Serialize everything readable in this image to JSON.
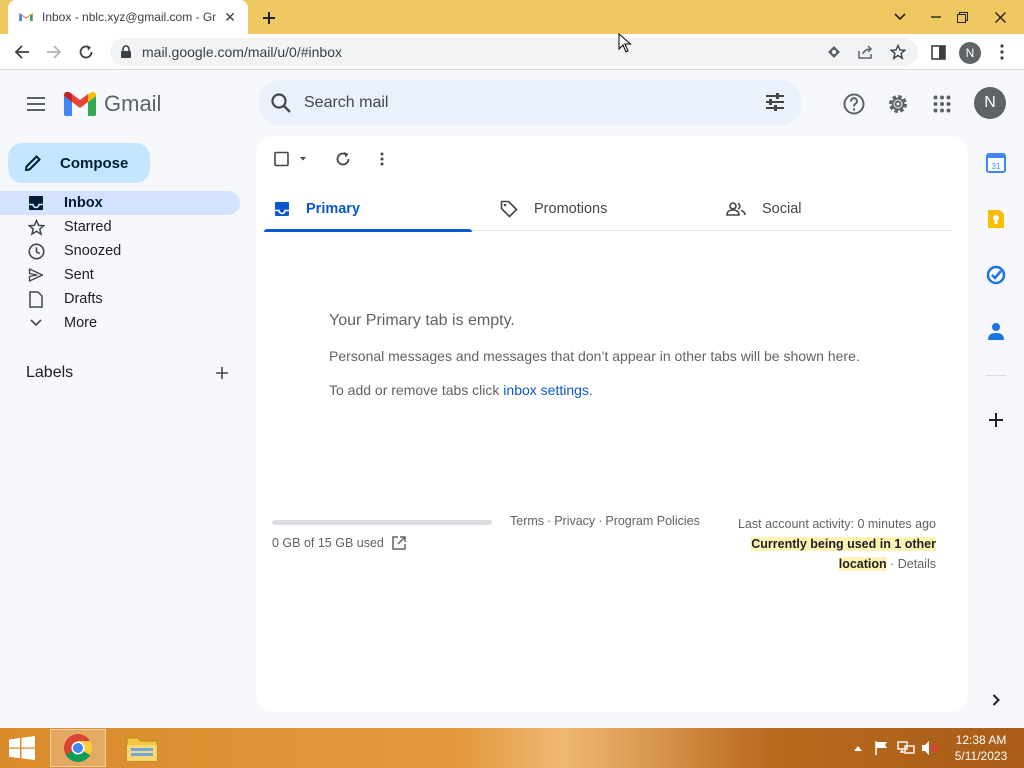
{
  "browser": {
    "tab_title": "Inbox - nblc.xyz@gmail.com - Gmail",
    "url": "mail.google.com/mail/u/0/#inbox",
    "profile_initial": "N"
  },
  "gmail": {
    "logo_text": "Gmail",
    "search_placeholder": "Search mail",
    "avatar_initial": "N",
    "compose_label": "Compose"
  },
  "sidebar": {
    "items": [
      {
        "label": "Inbox",
        "icon": "inbox-icon",
        "active": true
      },
      {
        "label": "Starred",
        "icon": "star-icon"
      },
      {
        "label": "Snoozed",
        "icon": "clock-icon"
      },
      {
        "label": "Sent",
        "icon": "send-icon"
      },
      {
        "label": "Drafts",
        "icon": "draft-icon"
      },
      {
        "label": "More",
        "icon": "chevron-down-icon"
      }
    ],
    "labels_heading": "Labels"
  },
  "main": {
    "tabs": [
      {
        "label": "Primary",
        "icon": "inbox-icon",
        "active": true
      },
      {
        "label": "Promotions",
        "icon": "tag-icon"
      },
      {
        "label": "Social",
        "icon": "people-icon"
      }
    ],
    "empty_title": "Your Primary tab is empty.",
    "empty_desc": "Personal messages and messages that don’t appear in other tabs will be shown here.",
    "empty_hint_prefix": "To add or remove tabs click ",
    "empty_hint_link": "inbox settings",
    "empty_hint_suffix": "."
  },
  "footer": {
    "storage": "0 GB of 15 GB used",
    "storage_fraction": 0,
    "links": [
      "Terms",
      "Privacy",
      "Program Policies"
    ],
    "activity": "Last account activity: 0 minutes ago",
    "activity_highlight_1": "Currently being used in 1 other",
    "activity_highlight_2": "location",
    "details": "Details"
  },
  "taskbar": {
    "time": "12:38 AM",
    "date": "5/11/2023"
  },
  "colors": {
    "tabstrip": "#f0c862",
    "accent": "#0b57d0",
    "compose": "#c2e7ff",
    "active_nav": "#d3e3fd"
  }
}
